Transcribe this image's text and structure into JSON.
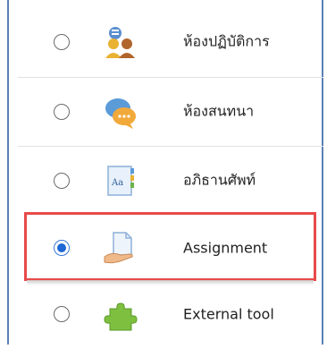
{
  "activities": [
    {
      "label": "ห้องปฏิบัติการ",
      "icon": "workshop-people-icon",
      "selected": false
    },
    {
      "label": "ห้องสนทนา",
      "icon": "chat-bubbles-icon",
      "selected": false
    },
    {
      "label": "อภิธานศัพท์",
      "icon": "glossary-book-icon",
      "selected": false
    },
    {
      "label": "Assignment",
      "icon": "assignment-hand-document-icon",
      "selected": true
    },
    {
      "label": "External tool",
      "icon": "external-tool-puzzle-icon",
      "selected": false
    }
  ],
  "colors": {
    "frame_border": "#5b80b5",
    "highlight_border": "#e84a4a",
    "radio_checked": "#1f66d6"
  }
}
